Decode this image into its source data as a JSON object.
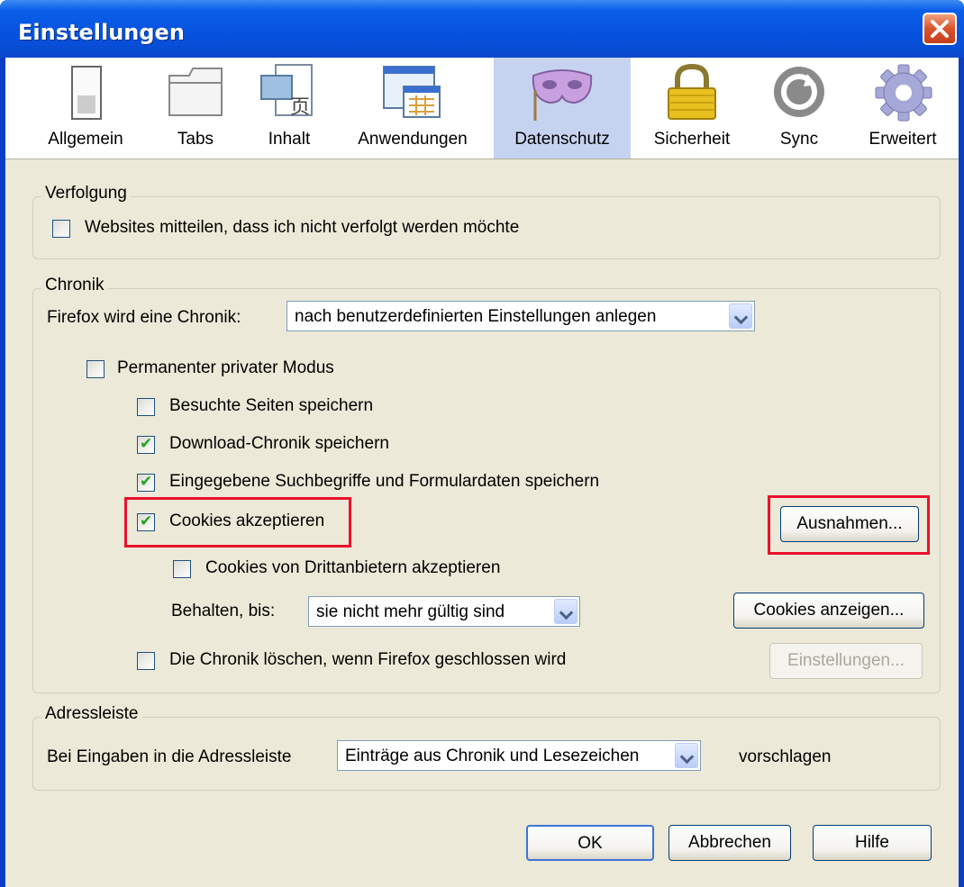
{
  "window": {
    "title": "Einstellungen"
  },
  "toolbar": {
    "tabs": [
      {
        "label": "Allgemein",
        "icon": "switch-icon"
      },
      {
        "label": "Tabs",
        "icon": "tabs-folder-icon"
      },
      {
        "label": "Inhalt",
        "icon": "content-page-icon"
      },
      {
        "label": "Anwendungen",
        "icon": "applications-window-icon"
      },
      {
        "label": "Datenschutz",
        "icon": "mask-icon",
        "selected": true
      },
      {
        "label": "Sicherheit",
        "icon": "padlock-icon"
      },
      {
        "label": "Sync",
        "icon": "sync-icon"
      },
      {
        "label": "Erweitert",
        "icon": "gear-icon"
      }
    ]
  },
  "tracking": {
    "group_label": "Verfolgung",
    "do_not_track": {
      "label": "Websites mitteilen, dass ich nicht verfolgt werden möchte",
      "checked": false
    }
  },
  "history": {
    "group_label": "Chronik",
    "mode_label": "Firefox wird eine Chronik:",
    "mode_value": "nach benutzerdefinierten Einstellungen anlegen",
    "private_mode": {
      "label": "Permanenter privater Modus",
      "checked": false
    },
    "visited": {
      "label": "Besuchte Seiten speichern",
      "checked": false
    },
    "downloads": {
      "label": "Download-Chronik speichern",
      "checked": true
    },
    "forms": {
      "label": "Eingegebene Suchbegriffe und Formulardaten speichern",
      "checked": true
    },
    "cookies": {
      "label": "Cookies akzeptieren",
      "checked": true
    },
    "exceptions_button": "Ausnahmen...",
    "third_party": {
      "label": "Cookies von Drittanbietern akzeptieren",
      "checked": false
    },
    "keep_label": "Behalten, bis:",
    "keep_value": "sie nicht mehr gültig sind",
    "show_cookies_button": "Cookies anzeigen...",
    "clear_on_close": {
      "label": "Die Chronik löschen, wenn Firefox geschlossen wird",
      "checked": false
    },
    "settings_button": "Einstellungen..."
  },
  "addressbar": {
    "group_label": "Adressleiste",
    "label": "Bei Eingaben in die Adressleiste",
    "value": "Einträge aus Chronik und Lesezeichen",
    "suffix": "vorschlagen"
  },
  "footer": {
    "ok": "OK",
    "cancel": "Abbrechen",
    "help": "Hilfe"
  },
  "colors": {
    "titlebar": "#0652df",
    "dialog_bg": "#ece9d8",
    "highlight": "#e8122b",
    "selected_tab": "#c6d3f0"
  }
}
